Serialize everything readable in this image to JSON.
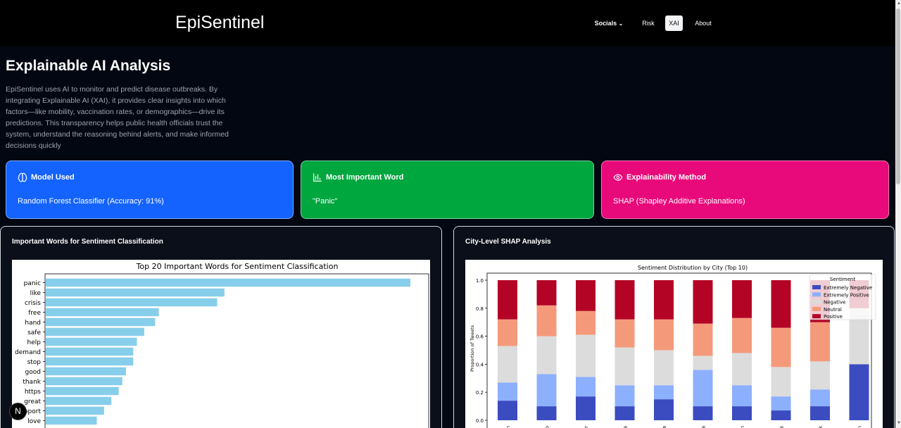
{
  "nav": {
    "brand": "EpiSentinel",
    "items": [
      "Socials",
      "Risk",
      "XAI",
      "About"
    ],
    "socials_caret": "⌄"
  },
  "page": {
    "title": "Explainable AI Analysis",
    "intro": "EpiSentinel uses AI to monitor and predict disease outbreaks. By integrating Explainable AI (XAI), it provides clear insights into which factors—like mobility, vaccination rates, or demographics—drive its predictions. This transparency helps public health officials trust the system, understand the reasoning behind alerts, and make informed decisions quickly"
  },
  "cards": [
    {
      "title": "Model Used",
      "value": "Random Forest Classifier (Accuracy: 91%)",
      "icon": "brain-icon",
      "color": "#1463ff"
    },
    {
      "title": "Most Important Word",
      "value": "\"Panic\"",
      "icon": "bar-chart-icon",
      "color": "#00a63e"
    },
    {
      "title": "Explainability Method",
      "value": "SHAP (Shapley Additive Explanations)",
      "icon": "eye-icon",
      "color": "#e8097a"
    }
  ],
  "panels": {
    "left_title": "Important Words for Sentiment Classification",
    "right_title": "City-Level SHAP Analysis"
  },
  "fab_label": "N",
  "chart_data": [
    {
      "type": "bar",
      "orientation": "horizontal",
      "title": "Top 20 Important Words for Sentiment Classification",
      "categories": [
        "panic",
        "like",
        "crisis",
        "free",
        "hand",
        "safe",
        "help",
        "demand",
        "stop",
        "good",
        "thank",
        "https",
        "great",
        "support",
        "love"
      ],
      "visible_labels": [
        "panic",
        "like",
        "crisis",
        "free",
        "hand",
        "safe",
        "help",
        "demand",
        "stop",
        "good",
        "thank",
        "https",
        "great",
        "pport",
        "love"
      ],
      "values": [
        1.0,
        0.49,
        0.47,
        0.31,
        0.3,
        0.27,
        0.25,
        0.24,
        0.24,
        0.22,
        0.21,
        0.2,
        0.18,
        0.16,
        0.14
      ],
      "bar_color": "#87ceeb"
    },
    {
      "type": "bar",
      "stacked": true,
      "title": "Sentiment Distribution by City (Top 10)",
      "ylabel": "Proportion of Tweets",
      "ylim": [
        0,
        1.0
      ],
      "yticks": [
        "0.0",
        "0.2",
        "0.4",
        "0.6",
        "0.8",
        "1.0"
      ],
      "categories": [
        "n",
        "co",
        "ar",
        "a",
        "ia",
        "la",
        "in",
        "s",
        "rk",
        "on"
      ],
      "legend": {
        "title": "Sentiment",
        "position": "top-right"
      },
      "series": [
        {
          "name": "Extremely Negative",
          "color": "#3b4cc0",
          "values": [
            0.14,
            0.1,
            0.17,
            0.1,
            0.15,
            0.1,
            0.1,
            0.07,
            0.1,
            0.4
          ]
        },
        {
          "name": "Extremely Positive",
          "color": "#8db0fe",
          "values": [
            0.13,
            0.23,
            0.14,
            0.15,
            0.1,
            0.26,
            0.15,
            0.1,
            0.12,
            0.0
          ]
        },
        {
          "name": "Negative",
          "color": "#dddcdc",
          "values": [
            0.26,
            0.27,
            0.3,
            0.27,
            0.25,
            0.1,
            0.23,
            0.21,
            0.2,
            0.4
          ]
        },
        {
          "name": "Neutral",
          "color": "#f49a7b",
          "values": [
            0.19,
            0.22,
            0.17,
            0.2,
            0.22,
            0.23,
            0.25,
            0.28,
            0.28,
            0.0
          ]
        },
        {
          "name": "Positive",
          "color": "#b40426",
          "values": [
            0.28,
            0.18,
            0.22,
            0.28,
            0.28,
            0.31,
            0.27,
            0.34,
            0.3,
            0.2
          ]
        }
      ]
    }
  ]
}
